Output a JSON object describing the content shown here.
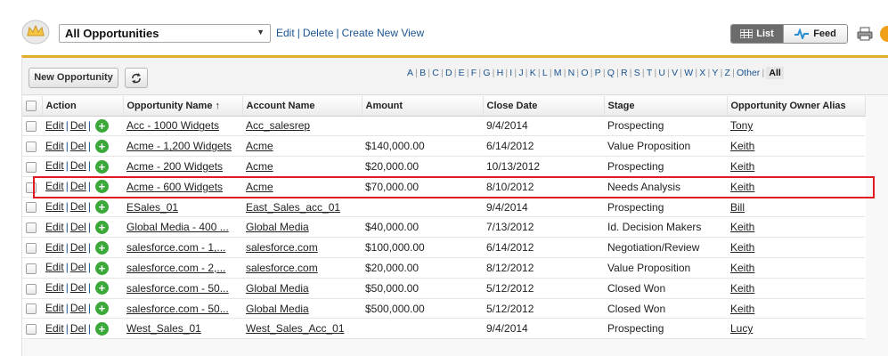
{
  "header": {
    "view_name": "All Opportunities",
    "edit_link": "Edit",
    "delete_link": "Delete",
    "create_view_link": "Create New View",
    "list_label": "List",
    "feed_label": "Feed"
  },
  "toolbar": {
    "new_button": "New Opportunity",
    "letters": [
      "A",
      "B",
      "C",
      "D",
      "E",
      "F",
      "G",
      "H",
      "I",
      "J",
      "K",
      "L",
      "M",
      "N",
      "O",
      "P",
      "Q",
      "R",
      "S",
      "T",
      "U",
      "V",
      "W",
      "X",
      "Y",
      "Z",
      "Other",
      "All"
    ]
  },
  "table": {
    "columns": [
      "Action",
      "Opportunity Name ↑",
      "Account Name",
      "Amount",
      "Close Date",
      "Stage",
      "Opportunity Owner Alias"
    ],
    "action_edit": "Edit",
    "action_del": "Del",
    "rows": [
      {
        "name": "Acc - 1000 Widgets",
        "account": "Acc_salesrep",
        "amount": "",
        "close": "9/4/2014",
        "stage": "Prospecting",
        "owner": "Tony"
      },
      {
        "name": "Acme - 1,200 Widgets",
        "account": "Acme",
        "amount": "$140,000.00",
        "close": "6/14/2012",
        "stage": "Value Proposition",
        "owner": "Keith"
      },
      {
        "name": "Acme - 200 Widgets",
        "account": "Acme",
        "amount": "$20,000.00",
        "close": "10/13/2012",
        "stage": "Prospecting",
        "owner": "Keith"
      },
      {
        "name": "Acme - 600 Widgets",
        "account": "Acme",
        "amount": "$70,000.00",
        "close": "8/10/2012",
        "stage": "Needs Analysis",
        "owner": "Keith"
      },
      {
        "name": "ESales_01",
        "account": "East_Sales_acc_01",
        "amount": "",
        "close": "9/4/2014",
        "stage": "Prospecting",
        "owner": "Bill"
      },
      {
        "name": "Global Media - 400 ...",
        "account": "Global Media",
        "amount": "$40,000.00",
        "close": "7/13/2012",
        "stage": "Id. Decision Makers",
        "owner": "Keith"
      },
      {
        "name": "salesforce.com - 1,...",
        "account": "salesforce.com",
        "amount": "$100,000.00",
        "close": "6/14/2012",
        "stage": "Negotiation/Review",
        "owner": "Keith"
      },
      {
        "name": "salesforce.com - 2,...",
        "account": "salesforce.com",
        "amount": "$20,000.00",
        "close": "8/12/2012",
        "stage": "Value Proposition",
        "owner": "Keith"
      },
      {
        "name": "salesforce.com - 50...",
        "account": "Global Media",
        "amount": "$50,000.00",
        "close": "5/12/2012",
        "stage": "Closed Won",
        "owner": "Keith"
      },
      {
        "name": "salesforce.com - 50...",
        "account": "Global Media",
        "amount": "$500,000.00",
        "close": "5/12/2012",
        "stage": "Closed Won",
        "owner": "Keith"
      },
      {
        "name": "West_Sales_01",
        "account": "West_Sales_Acc_01",
        "amount": "",
        "close": "9/4/2014",
        "stage": "Prospecting",
        "owner": "Lucy"
      }
    ]
  },
  "colors": {
    "accent_border": "#e4ad2a",
    "highlight": "#e11b22",
    "link": "#1a5490"
  }
}
